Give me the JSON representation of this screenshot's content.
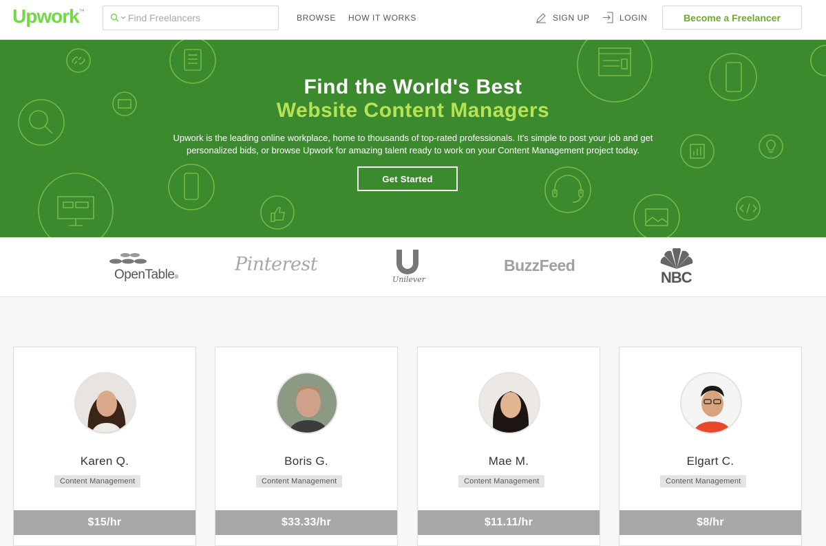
{
  "header": {
    "logo": "Upwork",
    "logo_mark": "™",
    "search_placeholder": "Find Freelancers",
    "nav": {
      "browse": "BROWSE",
      "how_it_works": "HOW IT WORKS",
      "sign_up": "SIGN UP",
      "login": "LOGIN"
    },
    "become_freelancer": "Become a Freelancer"
  },
  "hero": {
    "title_line1": "Find the World's Best",
    "title_line2": "Website Content Managers",
    "description": "Upwork is the leading online workplace, home to thousands of top-rated professionals. It's simple to post your job and get personalized bids, or browse Upwork for amazing talent ready to work on your Content Management project today.",
    "cta": "Get Started"
  },
  "brands": {
    "opentable": "OpenTable",
    "opentable_mark": "®",
    "pinterest": "Pinterest",
    "unilever": "Unilever",
    "buzzfeed": "BuzzFeed",
    "nbc": "NBC"
  },
  "freelancers": [
    {
      "name": "Karen Q.",
      "skill": "Content Management",
      "rate": "$15/hr"
    },
    {
      "name": "Boris G.",
      "skill": "Content Management",
      "rate": "$33.33/hr"
    },
    {
      "name": "Mae M.",
      "skill": "Content Management",
      "rate": "$11.11/hr"
    },
    {
      "name": "Elgart C.",
      "skill": "Content Management",
      "rate": "$8/hr"
    }
  ],
  "colors": {
    "brand_green": "#6fda44",
    "hero_green": "#3c8a2e",
    "hero_accent": "#b6e355",
    "rate_bar": "#a8a8a8"
  }
}
